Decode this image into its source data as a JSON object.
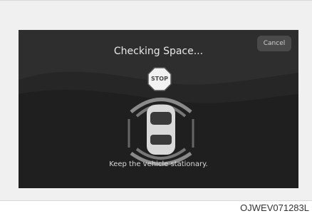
{
  "screen": {
    "title": "Checking Space...",
    "cancel_label": "Cancel",
    "stop_sign_text": "STOP",
    "hint": "Keep the vehicle stationary."
  },
  "figure_code": "OJWEV071283L",
  "colors": {
    "screen_bg": "#2e2e2e",
    "sensor_arc": "#8a8a8a",
    "stop_sign": "#f2f2f2"
  }
}
